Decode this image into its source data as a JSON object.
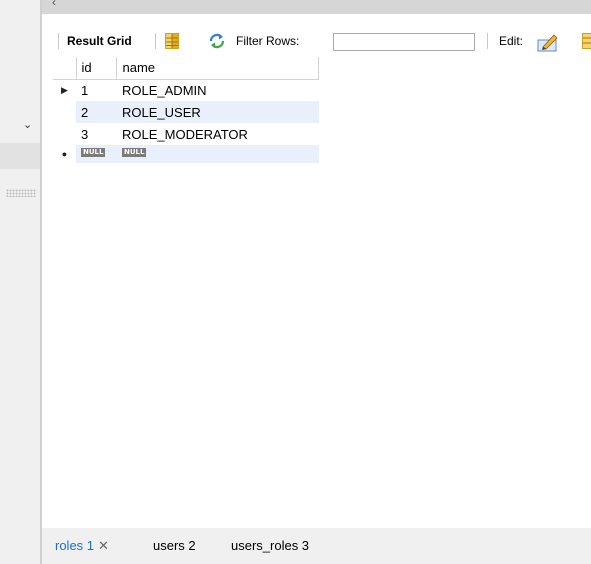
{
  "toolbar": {
    "result_grid_label": "Result Grid",
    "filter_rows_label": "Filter Rows:",
    "filter_value": "",
    "edit_label": "Edit:"
  },
  "grid": {
    "columns": [
      "id",
      "name"
    ],
    "rows": [
      {
        "id": "1",
        "name": "ROLE_ADMIN",
        "current": true
      },
      {
        "id": "2",
        "name": "ROLE_USER",
        "current": false
      },
      {
        "id": "3",
        "name": "ROLE_MODERATOR",
        "current": false
      }
    ],
    "new_row": {
      "id": "NULL",
      "name": "NULL"
    }
  },
  "tabs": [
    {
      "label": "roles 1",
      "active": true,
      "closable": true
    },
    {
      "label": "users 2",
      "active": false,
      "closable": false
    },
    {
      "label": "users_roles 3",
      "active": false,
      "closable": false
    }
  ],
  "colors": {
    "accent": "#1a6fd6",
    "alt_row": "#e9f0fb",
    "null_badge": "#7b7b7b"
  }
}
